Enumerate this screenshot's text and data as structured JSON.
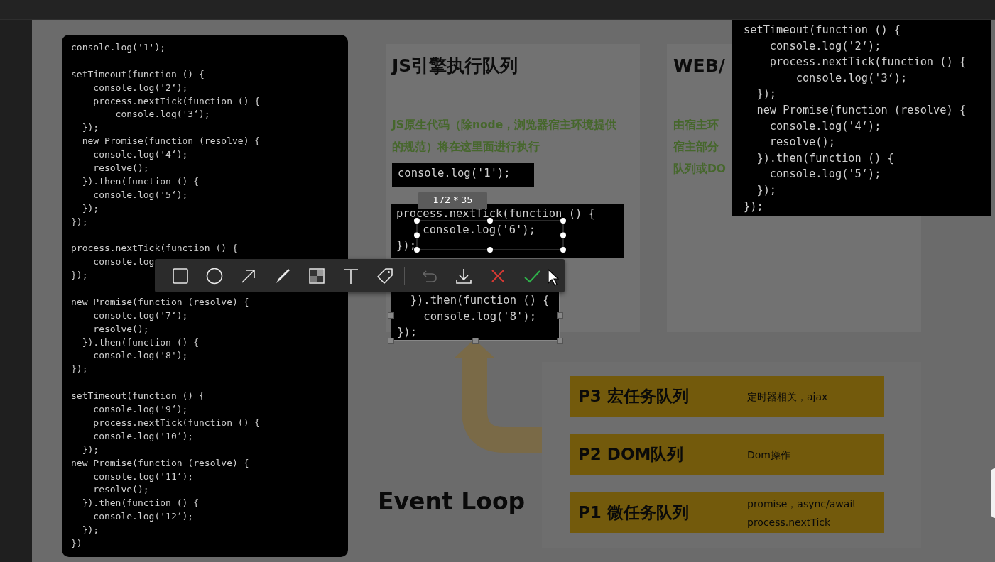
{
  "slide": {
    "code_panel": {
      "blocks": [
        {
          "lines": [
            "console.log('1');"
          ]
        },
        {
          "lines": [
            "setTimeout(function () {",
            "    console.log('2‘);",
            "    process.nextTick(function () {",
            "        console.log('3‘);",
            "  });",
            "  new Promise(function (resolve) {",
            "    console.log('4‘);",
            "    resolve();",
            "  }).then(function () {",
            "    console.log('5‘);",
            "  });",
            "});"
          ]
        },
        {
          "lines": [
            "process.nextTick(function () {",
            "    console.log",
            "});"
          ]
        },
        {
          "lines": [
            "new Promise(function (resolve) {",
            "    console.log('7‘);",
            "    resolve();",
            "  }).then(function () {",
            "    console.log('8');",
            "});"
          ]
        },
        {
          "lines": [
            "setTimeout(function () {",
            "    console.log('9‘);",
            "    process.nextTick(function () {",
            "    console.log('10‘);",
            "  });",
            "new Promise(function (resolve) {",
            "    console.log('11‘);",
            "    resolve();",
            "  }).then(function () {",
            "    console.log('12‘);",
            "  });",
            "})"
          ]
        }
      ]
    },
    "js_engine_card": {
      "title": "JS引擎执行队列",
      "description": [
        "JS原生代码（除node，浏览器宿主环境提供",
        "的规范）将在这里面进行执行"
      ],
      "snippets": [
        {
          "lines": [
            "console.log('1');"
          ]
        },
        {
          "lines": [
            "process.nextTick(function () {",
            "    console.log('6');",
            "});"
          ]
        },
        {
          "lines": [
            "  }).then(function () {",
            "    console.log('8');",
            "});"
          ]
        }
      ]
    },
    "web_card": {
      "title": "WEB/",
      "description": [
        "由宿主环",
        "宿主部分",
        "队列或DO"
      ]
    },
    "heading": "Event Loop",
    "queues": [
      {
        "name": "P3 宏任务队列",
        "details": [
          "定时器相关，ajax"
        ]
      },
      {
        "name": "P2 DOM队列",
        "details": [
          "Dom操作"
        ]
      },
      {
        "name": "P1 微任务队列",
        "details": [
          "promise，async/await",
          "process.nextTick"
        ]
      }
    ]
  },
  "capture_tool": {
    "size_label": "172 * 35",
    "drawing_tools": [
      {
        "kind": "rectangle"
      },
      {
        "kind": "ellipse"
      },
      {
        "kind": "arrow"
      },
      {
        "kind": "pen"
      },
      {
        "kind": "mosaic"
      },
      {
        "kind": "text"
      },
      {
        "kind": "tag"
      }
    ],
    "action_tools": [
      {
        "kind": "undo",
        "disabled": true
      },
      {
        "kind": "download",
        "disabled": false
      },
      {
        "kind": "cancel",
        "disabled": false
      },
      {
        "kind": "confirm",
        "disabled": false
      }
    ]
  },
  "floating_code": {
    "lines": [
      "setTimeout(function () {",
      "    console.log('2‘);",
      "    process.nextTick(function () {",
      "        console.log('3‘);",
      "  });",
      "  new Promise(function (resolve) {",
      "    console.log('4‘);",
      "    resolve();",
      "  }).then(function () {",
      "    console.log('5‘);",
      "  });",
      "});"
    ]
  }
}
